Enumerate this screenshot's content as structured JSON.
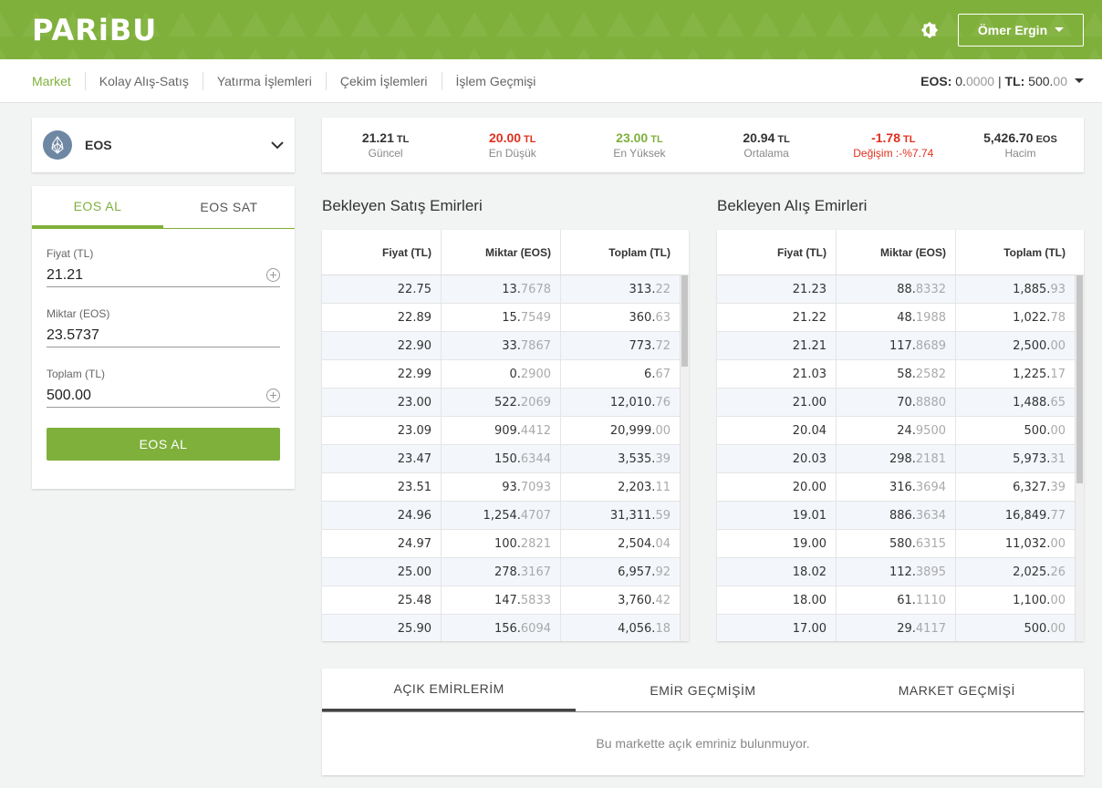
{
  "header": {
    "logo": "PARiBU",
    "user": "Ömer Ergin"
  },
  "nav": {
    "items": [
      "Market",
      "Kolay Alış-Satış",
      "Yatırma İşlemleri",
      "Çekim İşlemleri",
      "İşlem Geçmişi"
    ],
    "balance": {
      "eos_label": "EOS:",
      "eos_int": "0.",
      "eos_dec": "0000",
      "sep": "|",
      "tl_label": "TL:",
      "tl_int": "500.",
      "tl_dec": "00"
    }
  },
  "market": {
    "name": "EOS"
  },
  "trade": {
    "tab_buy": "EOS AL",
    "tab_sell": "EOS SAT",
    "price_label": "Fiyat (TL)",
    "price_value": "21.21",
    "amount_label": "Miktar (EOS)",
    "amount_value": "23.5737",
    "total_label": "Toplam (TL)",
    "total_value": "500.00",
    "submit": "EOS AL"
  },
  "stats": [
    {
      "value": "21.21",
      "unit": "TL",
      "label": "Güncel"
    },
    {
      "value": "20.00",
      "unit": "TL",
      "label": "En Düşük"
    },
    {
      "value": "23.00",
      "unit": "TL",
      "label": "En Yüksek"
    },
    {
      "value": "20.94",
      "unit": "TL",
      "label": "Ortalama"
    },
    {
      "value": "-1.78",
      "unit": "TL",
      "label": "Değişim :-%7.74"
    },
    {
      "value": "5,426.70",
      "unit": "EOS",
      "label": "Hacim"
    }
  ],
  "sell_book": {
    "title": "Bekleyen Satış Emirleri",
    "headers": [
      "Fiyat (TL)",
      "Miktar (EOS)",
      "Toplam (TL)"
    ],
    "rows": [
      [
        "22.75",
        "13.",
        "7678",
        "313.",
        "22"
      ],
      [
        "22.89",
        "15.",
        "7549",
        "360.",
        "63"
      ],
      [
        "22.90",
        "33.",
        "7867",
        "773.",
        "72"
      ],
      [
        "22.99",
        "0.",
        "2900",
        "6.",
        "67"
      ],
      [
        "23.00",
        "522.",
        "2069",
        "12,010.",
        "76"
      ],
      [
        "23.09",
        "909.",
        "4412",
        "20,999.",
        "00"
      ],
      [
        "23.47",
        "150.",
        "6344",
        "3,535.",
        "39"
      ],
      [
        "23.51",
        "93.",
        "7093",
        "2,203.",
        "11"
      ],
      [
        "24.96",
        "1,254.",
        "4707",
        "31,311.",
        "59"
      ],
      [
        "24.97",
        "100.",
        "2821",
        "2,504.",
        "04"
      ],
      [
        "25.00",
        "278.",
        "3167",
        "6,957.",
        "92"
      ],
      [
        "25.48",
        "147.",
        "5833",
        "3,760.",
        "42"
      ],
      [
        "25.90",
        "156.",
        "6094",
        "4,056.",
        "18"
      ]
    ]
  },
  "buy_book": {
    "title": "Bekleyen Alış Emirleri",
    "headers": [
      "Fiyat (TL)",
      "Miktar (EOS)",
      "Toplam (TL)"
    ],
    "rows": [
      [
        "21.23",
        "88.",
        "8332",
        "1,885.",
        "93"
      ],
      [
        "21.22",
        "48.",
        "1988",
        "1,022.",
        "78"
      ],
      [
        "21.21",
        "117.",
        "8689",
        "2,500.",
        "00"
      ],
      [
        "21.03",
        "58.",
        "2582",
        "1,225.",
        "17"
      ],
      [
        "21.00",
        "70.",
        "8880",
        "1,488.",
        "65"
      ],
      [
        "20.04",
        "24.",
        "9500",
        "500.",
        "00"
      ],
      [
        "20.03",
        "298.",
        "2181",
        "5,973.",
        "31"
      ],
      [
        "20.00",
        "316.",
        "3694",
        "6,327.",
        "39"
      ],
      [
        "19.01",
        "886.",
        "3634",
        "16,849.",
        "77"
      ],
      [
        "19.00",
        "580.",
        "6315",
        "11,032.",
        "00"
      ],
      [
        "18.02",
        "112.",
        "3895",
        "2,025.",
        "26"
      ],
      [
        "18.00",
        "61.",
        "1110",
        "1,100.",
        "00"
      ],
      [
        "17.00",
        "29.",
        "4117",
        "500.",
        "00"
      ]
    ]
  },
  "orders": {
    "tabs": [
      "AÇIK EMİRLERİM",
      "EMİR GEÇMİŞİM",
      "MARKET GEÇMİŞİ"
    ],
    "empty": "Bu markette açık emriniz bulunmuyor."
  },
  "colors": {
    "brand": "#7fb03b",
    "red": "#e0301e"
  }
}
